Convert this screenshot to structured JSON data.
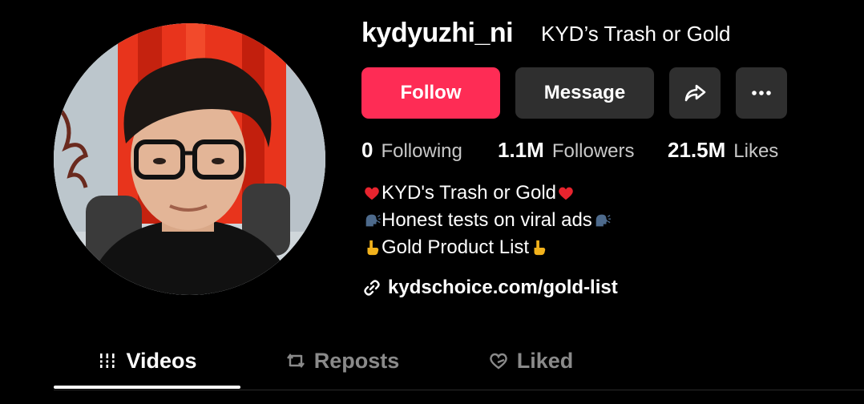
{
  "profile": {
    "username": "kydyuzhi_ni",
    "nickname": "KYD’s Trash or Gold"
  },
  "actions": {
    "follow_label": "Follow",
    "message_label": "Message",
    "share_icon": "share-icon",
    "more_icon": "more-icon"
  },
  "stats": {
    "following": {
      "value": "0",
      "label": "Following"
    },
    "followers": {
      "value": "1.1M",
      "label": "Followers"
    },
    "likes": {
      "value": "21.5M",
      "label": "Likes"
    }
  },
  "bio": {
    "line1": "KYD's Trash or Gold",
    "line2": "Honest tests on viral ads",
    "line3": "Gold Product List",
    "line1_emoji": "red-heart",
    "line2_emoji": "speaking-head",
    "line3_emoji": "pointing-down"
  },
  "link": {
    "text": "kydschoice.com/gold-list",
    "icon": "link-icon"
  },
  "tabs": [
    {
      "label": "Videos",
      "icon": "grid-bars-icon",
      "active": true
    },
    {
      "label": "Reposts",
      "icon": "repost-icon",
      "active": false
    },
    {
      "label": "Liked",
      "icon": "heart-slash-icon",
      "active": false
    }
  ],
  "colors": {
    "background": "#000000",
    "follow_button": "#fe2c55",
    "secondary_button": "#2f2f2f",
    "muted_text": "#8a8a8a"
  }
}
